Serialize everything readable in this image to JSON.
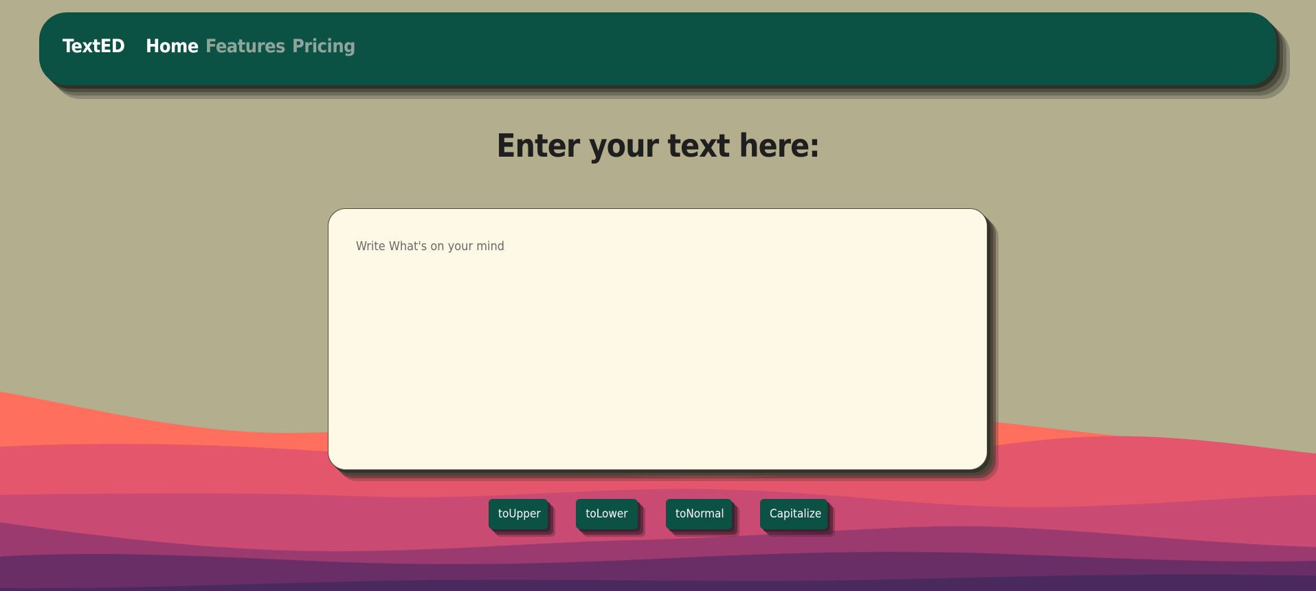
{
  "app": {
    "brand": "TextED"
  },
  "nav": {
    "items": [
      {
        "label": "Home",
        "active": true
      },
      {
        "label": "Features",
        "active": false
      },
      {
        "label": "Pricing",
        "active": false
      }
    ]
  },
  "main": {
    "heading": "Enter your text here:",
    "textarea": {
      "value": "",
      "placeholder": "Write What's on your mind"
    },
    "buttons": {
      "upper": "toUpper",
      "lower": "toLower",
      "normal": "toNormal",
      "capitalize": "Capitalize"
    }
  },
  "colors": {
    "background": "#b3ae8e",
    "navbar": "#0b5144",
    "textarea_bg": "#fef9e6",
    "button": "#0b5144",
    "wave_1": "#ff6f5e",
    "wave_2": "#e4566b",
    "wave_3": "#c94a72",
    "wave_4": "#9a3a6f",
    "wave_5": "#6a2e66",
    "wave_6": "#4a2a5e"
  }
}
